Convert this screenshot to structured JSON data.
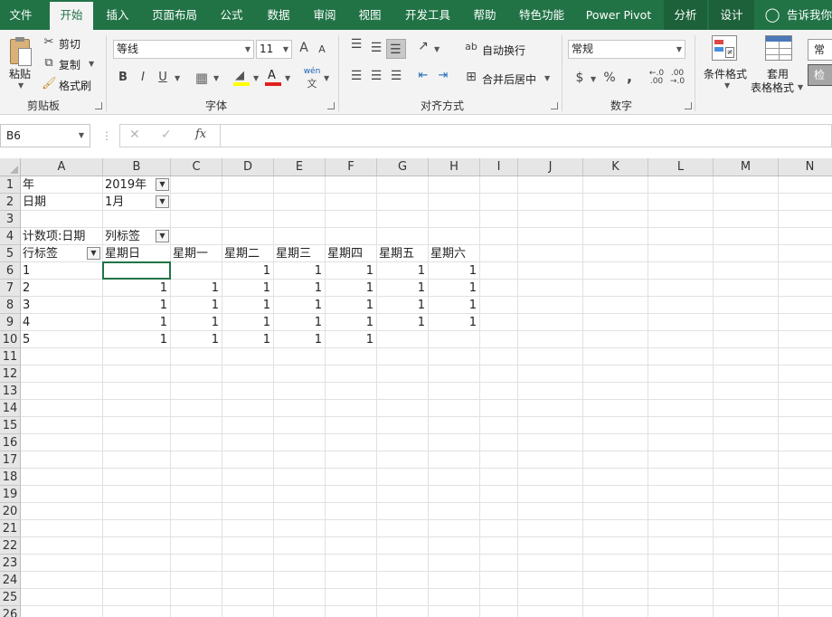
{
  "tabs": [
    "文件",
    "开始",
    "插入",
    "页面布局",
    "公式",
    "数据",
    "审阅",
    "视图",
    "开发工具",
    "帮助",
    "特色功能",
    "Power Pivot",
    "分析",
    "设计",
    "告诉我你"
  ],
  "clipboard": {
    "paste": "粘贴",
    "cut": "剪切",
    "copy": "复制",
    "format_painter": "格式刷",
    "group": "剪贴板"
  },
  "font": {
    "name": "等线",
    "size": "11",
    "grow": "A",
    "shrink": "A",
    "bold": "B",
    "italic": "I",
    "underline": "U",
    "fill_color_icon": "paint-bucket-icon",
    "font_color": "A",
    "phonetic": "wén",
    "group": "字体"
  },
  "alignment": {
    "wrap": "自动换行",
    "merge": "合并后居中",
    "group": "对齐方式"
  },
  "number": {
    "format": "常规",
    "currency": "$",
    "percent": "%",
    "comma": ",",
    "inc_decimal": ".00",
    "dec_decimal": ".00",
    "group": "数字"
  },
  "styles": {
    "conditional": "条件格式",
    "table_format_1": "套用",
    "table_format_2": "表格格式",
    "style_box_1": "常规",
    "style_box_2": "检查"
  },
  "formula_bar": {
    "name_box": "B6",
    "cancel": "✕",
    "enter": "✓",
    "fx": "fx",
    "value": ""
  },
  "columns": [
    "A",
    "B",
    "C",
    "D",
    "E",
    "F",
    "G",
    "H",
    "I",
    "J",
    "K",
    "L",
    "M",
    "N"
  ],
  "rows": [
    "1",
    "2",
    "3",
    "4",
    "5",
    "6",
    "7",
    "8",
    "9",
    "10",
    "11",
    "12",
    "13",
    "14",
    "15",
    "16",
    "17",
    "18",
    "19",
    "20",
    "21",
    "22",
    "23",
    "24",
    "25",
    "26"
  ],
  "pivot": {
    "filter_year_label": "年",
    "filter_year_value": "2019年",
    "filter_date_label": "日期",
    "filter_date_value": "1月",
    "value_field": "计数项:日期",
    "column_labels": "列标签",
    "row_labels": "行标签",
    "headers": [
      "星期日",
      "星期一",
      "星期二",
      "星期三",
      "星期四",
      "星期五",
      "星期六"
    ],
    "data": [
      [
        "1",
        "",
        "",
        "1",
        "1",
        "1",
        "1",
        "1"
      ],
      [
        "2",
        "1",
        "1",
        "1",
        "1",
        "1",
        "1",
        "1"
      ],
      [
        "3",
        "1",
        "1",
        "1",
        "1",
        "1",
        "1",
        "1"
      ],
      [
        "4",
        "1",
        "1",
        "1",
        "1",
        "1",
        "1",
        "1"
      ],
      [
        "5",
        "1",
        "1",
        "1",
        "1",
        "1",
        "",
        ""
      ]
    ]
  },
  "colors": {
    "excel_green": "#217346",
    "ribbon_bg": "#f3f3f3"
  }
}
